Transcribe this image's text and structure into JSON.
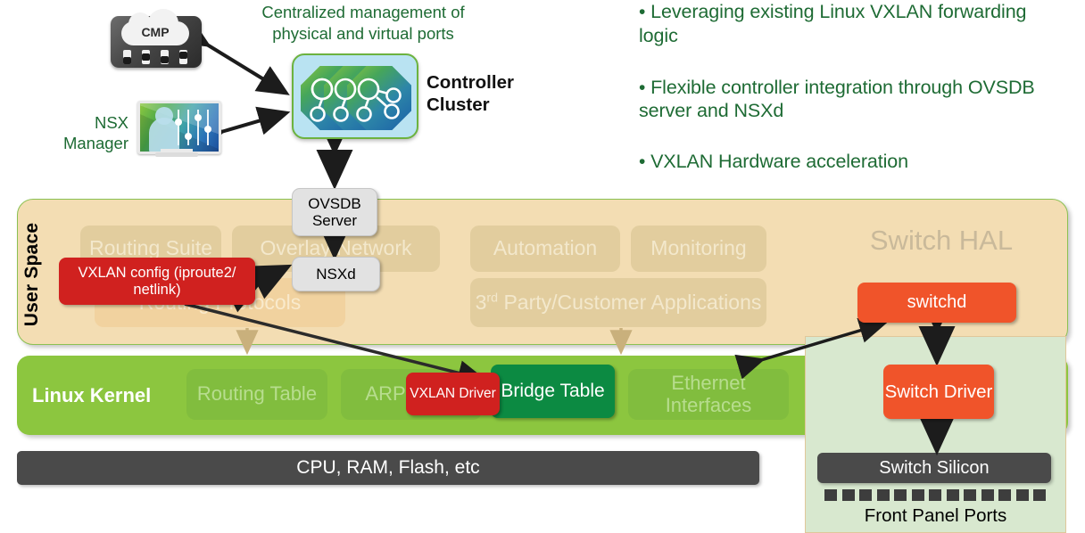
{
  "caption": "Centralized management of physical and virtual ports",
  "bullets": [
    "Leveraging existing Linux VXLAN forwarding logic",
    "Flexible controller integration through OVSDB server and NSXd",
    "VXLAN Hardware acceleration"
  ],
  "bullet_marker": "•",
  "icons": {
    "cmp_label": "CMP",
    "nsx_manager_label": "NSX Manager",
    "controller_cluster_label": "Controller Cluster"
  },
  "processes": {
    "ovsdb_server": "OVSDB Server",
    "nsxd": "NSXd"
  },
  "user_space": {
    "title": "User Space",
    "hal_title": "Switch HAL",
    "ghost_boxes": [
      "Routing Suite",
      "Overlay Network",
      "Automation",
      "Monitoring",
      "Routing Protocols",
      "3rd Party/Customer Applications"
    ],
    "third_party_sup": "rd",
    "third_party_pre": "3",
    "third_party_post": " Party/Customer Applications",
    "vxlan_config": "VXLAN config (iproute2/ netlink)",
    "switchd": "switchd"
  },
  "kernel": {
    "title": "Linux Kernel",
    "ghost_boxes": [
      "Routing Table",
      "ARP Table",
      "Ethernet Interfaces"
    ],
    "vxlan_driver": "VXLAN Driver",
    "bridge_table": "Bridge Table",
    "switch_driver": "Switch Driver"
  },
  "hardware": {
    "cpu_ram": "CPU, RAM, Flash, etc",
    "switch_silicon": "Switch Silicon",
    "front_panel_ports": "Front Panel Ports",
    "port_count": 13
  },
  "colors": {
    "green_text": "#1e6b34",
    "user_space_bg": "#f3ddb3",
    "kernel_bg": "#8cc63f",
    "red_chip": "#d0211f",
    "orange_chip": "#f0542a",
    "dark_green_chip": "#0c8a42",
    "hardware_bg": "#4a4a4a",
    "silicon_panel_bg": "#d8e8cf",
    "cluster_bg": "#b9e3f2",
    "cluster_border": "#6cb33f"
  }
}
